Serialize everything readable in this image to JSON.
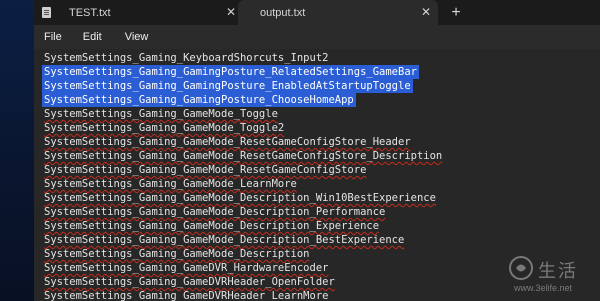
{
  "tabs": [
    {
      "label": "TEST.txt",
      "close_glyph": "✕",
      "icon": "file-icon"
    },
    {
      "label": "output.txt",
      "close_glyph": "✕",
      "icon": "file-icon"
    }
  ],
  "new_tab_glyph": "+",
  "menu": {
    "items": [
      "File",
      "Edit",
      "View"
    ]
  },
  "editor": {
    "lines": [
      {
        "text": "SystemSettings_Gaming_KeyboardShorcuts_Input2",
        "selected": false,
        "squiggle": false
      },
      {
        "text": "SystemSettings_Gaming_GamingPosture_RelatedSettings_GameBar",
        "selected": true,
        "squiggle": false
      },
      {
        "text": "SystemSettings_Gaming_GamingPosture_EnabledAtStartupToggle",
        "selected": true,
        "squiggle": false
      },
      {
        "text": "SystemSettings_Gaming_GamingPosture_ChooseHomeApp",
        "selected": true,
        "squiggle": false
      },
      {
        "text": "SystemSettings_Gaming_GameMode_Toggle",
        "selected": false,
        "squiggle": true
      },
      {
        "text": "SystemSettings_Gaming_GameMode_Toggle2",
        "selected": false,
        "squiggle": true
      },
      {
        "text": "SystemSettings_Gaming_GameMode_ResetGameConfigStore_Header",
        "selected": false,
        "squiggle": true
      },
      {
        "text": "SystemSettings_Gaming_GameMode_ResetGameConfigStore_Description",
        "selected": false,
        "squiggle": true
      },
      {
        "text": "SystemSettings_Gaming_GameMode_ResetGameConfigStore",
        "selected": false,
        "squiggle": true
      },
      {
        "text": "SystemSettings_Gaming_GameMode_LearnMore",
        "selected": false,
        "squiggle": true
      },
      {
        "text": "SystemSettings_Gaming_GameMode_Description_Win10BestExperience",
        "selected": false,
        "squiggle": true
      },
      {
        "text": "SystemSettings_Gaming_GameMode_Description_Performance",
        "selected": false,
        "squiggle": true
      },
      {
        "text": "SystemSettings_Gaming_GameMode_Description_Experience",
        "selected": false,
        "squiggle": true
      },
      {
        "text": "SystemSettings_Gaming_GameMode_Description_BestExperience",
        "selected": false,
        "squiggle": true
      },
      {
        "text": "SystemSettings_Gaming_GameMode_Description",
        "selected": false,
        "squiggle": true
      },
      {
        "text": "SystemSettings_Gaming_GameDVR_HardwareEncoder",
        "selected": false,
        "squiggle": true
      },
      {
        "text": "SystemSettings_Gaming_GameDVRHeader_OpenFolder",
        "selected": false,
        "squiggle": true
      },
      {
        "text": "SystemSettings_Gaming_GameDVRHeader_LearnMore",
        "selected": false,
        "squiggle": true
      }
    ]
  },
  "watermark": {
    "chinese": "生活",
    "url": "www.3elife.net"
  },
  "colors": {
    "selection": "#2b5ed4",
    "editor_bg": "#272727",
    "tabbar_bg": "#1b1b1b",
    "spell_squiggle": "#c42b1c"
  }
}
